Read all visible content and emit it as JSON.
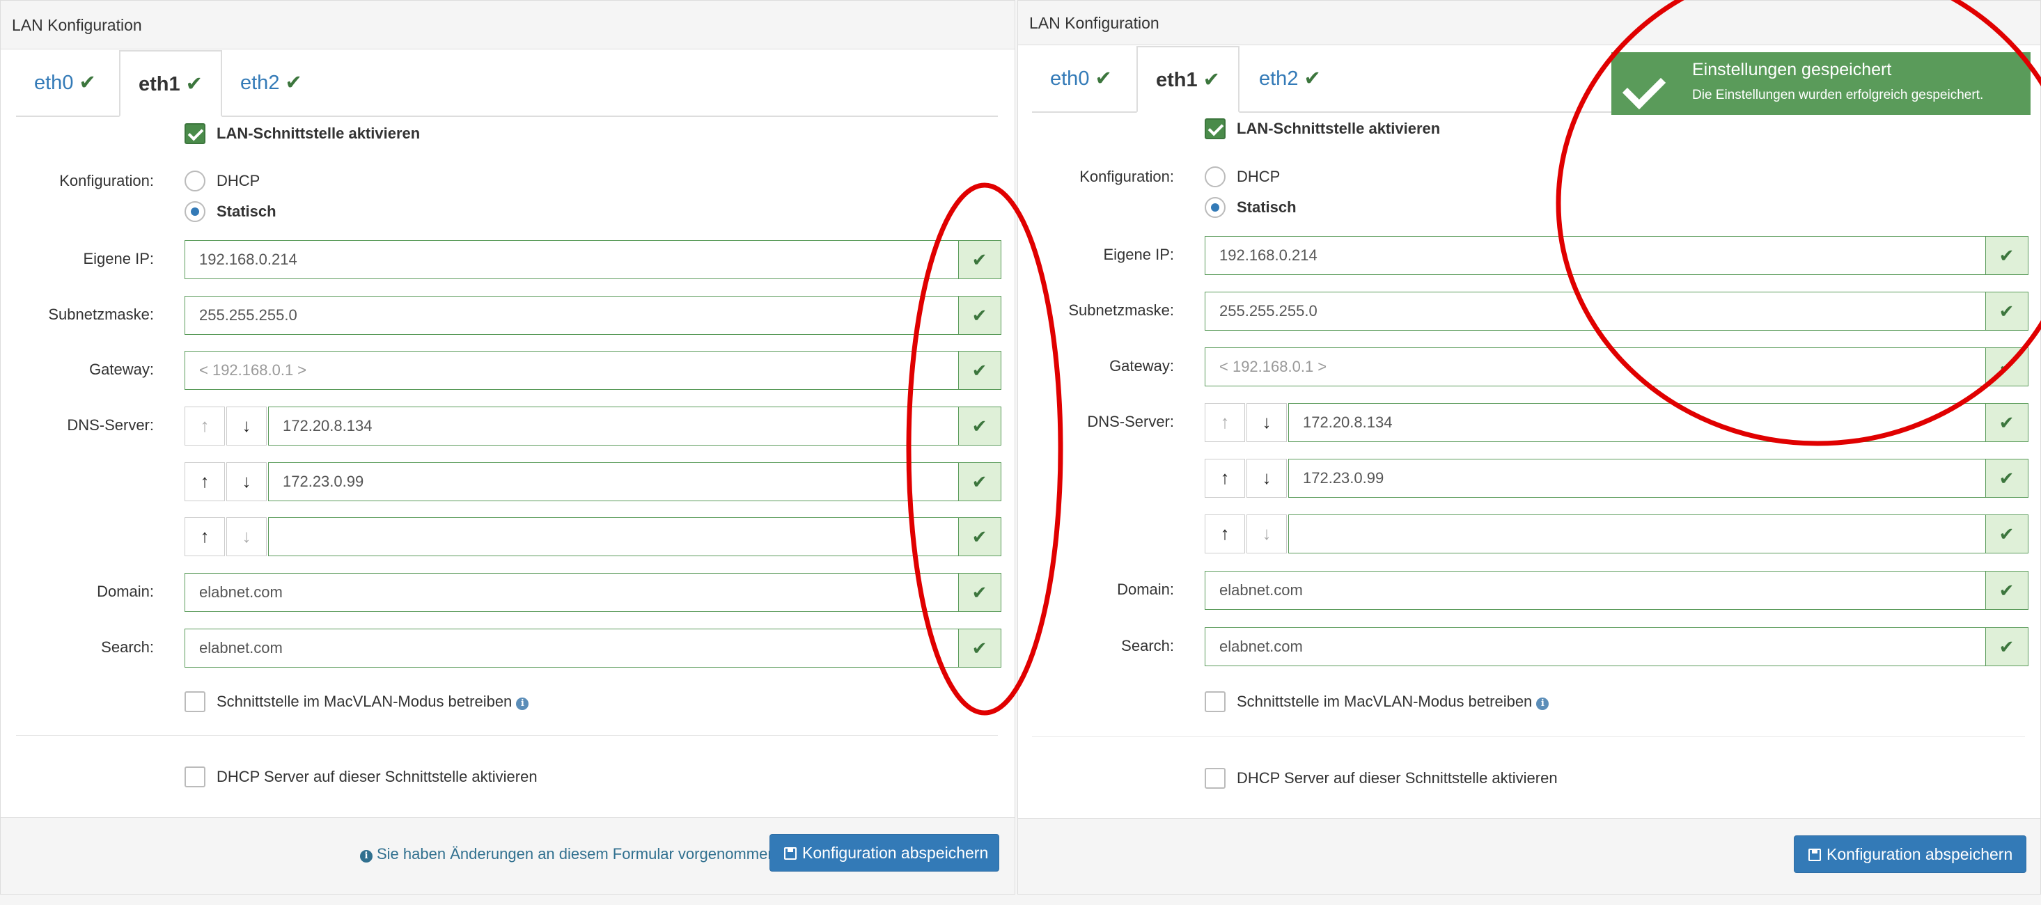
{
  "panels": {
    "left": {
      "title": "LAN Konfiguration",
      "tabs": [
        {
          "label": "eth0",
          "status": "✔"
        },
        {
          "label": "eth1",
          "status": "✔"
        },
        {
          "label": "eth2",
          "status": "✔"
        }
      ],
      "activate_label": "LAN-Schnittstelle aktivieren",
      "config_label": "Konfiguration:",
      "dhcp_label": "DHCP",
      "static_label": "Statisch",
      "ip_label": "Eigene IP:",
      "ip_value": "192.168.0.214",
      "mask_label": "Subnetzmaske:",
      "mask_value": "255.255.255.0",
      "gateway_label": "Gateway:",
      "gateway_placeholder": "< 192.168.0.1 >",
      "dns_label": "DNS-Server:",
      "dns": [
        "172.20.8.134",
        "172.23.0.99",
        ""
      ],
      "domain_label": "Domain:",
      "domain_value": "elabnet.com",
      "search_label": "Search:",
      "search_value": "elabnet.com",
      "macvlan_label": "Schnittstelle im MacVLAN-Modus betreiben",
      "dhcp_server_label": "DHCP Server auf dieser Schnittstelle aktivieren",
      "notice": "Sie haben Änderungen an diesem Formular vorgenommen.",
      "save_label": "Konfiguration abspeichern"
    },
    "right": {
      "title": "LAN Konfiguration",
      "tabs": [
        {
          "label": "eth0",
          "status": "✔"
        },
        {
          "label": "eth1",
          "status": "✔"
        },
        {
          "label": "eth2",
          "status": "✔"
        }
      ],
      "activate_label": "LAN-Schnittstelle aktivieren",
      "config_label": "Konfiguration:",
      "dhcp_label": "DHCP",
      "static_label": "Statisch",
      "ip_label": "Eigene IP:",
      "ip_value": "192.168.0.214",
      "mask_label": "Subnetzmaske:",
      "mask_value": "255.255.255.0",
      "gateway_label": "Gateway:",
      "gateway_placeholder": "< 192.168.0.1 >",
      "dns_label": "DNS-Server:",
      "dns": [
        "172.20.8.134",
        "172.23.0.99",
        ""
      ],
      "domain_label": "Domain:",
      "domain_value": "elabnet.com",
      "search_label": "Search:",
      "search_value": "elabnet.com",
      "macvlan_label": "Schnittstelle im MacVLAN-Modus betreiben",
      "dhcp_server_label": "DHCP Server auf dieser Schnittstelle aktivieren",
      "save_label": "Konfiguration abspeichern"
    }
  },
  "toast": {
    "title": "Einstellungen gespeichert",
    "text": "Die Einstellungen wurden erfolgreich gespeichert."
  },
  "icons": {
    "valid": "check-icon",
    "up": "arrow-up-icon",
    "down": "arrow-down-icon",
    "info": "info-icon",
    "save": "floppy-disk-icon"
  },
  "colors": {
    "success": "#3c763d",
    "success_bg": "#dff0d8",
    "primary": "#337ab7",
    "toast_bg": "#5a9b5a",
    "annotation": "#e00000"
  }
}
